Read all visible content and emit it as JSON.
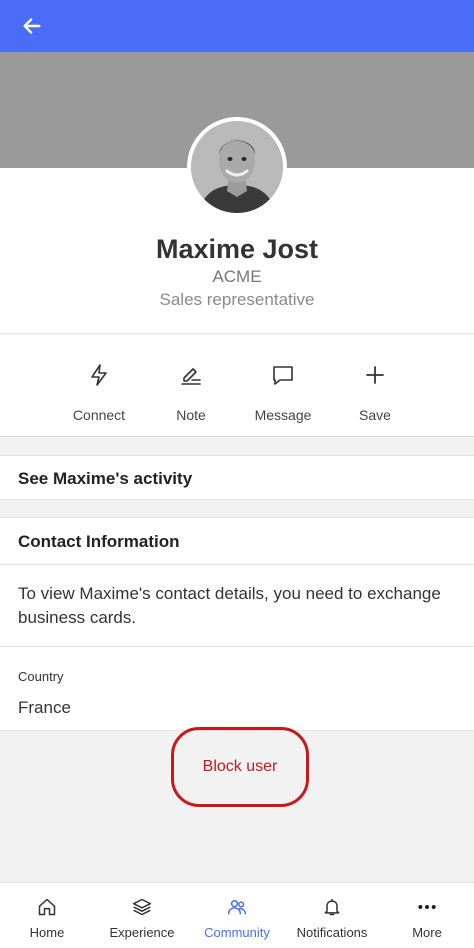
{
  "header": {
    "back_icon": "arrow-left-icon",
    "bg_color": "#4a6cf7"
  },
  "profile": {
    "name": "Maxime Jost",
    "company": "ACME",
    "role": "Sales representative",
    "avatar": "person-photo"
  },
  "actions": [
    {
      "label": "Connect",
      "icon": "lightning-icon"
    },
    {
      "label": "Note",
      "icon": "note-pen-icon"
    },
    {
      "label": "Message",
      "icon": "chat-bubble-icon"
    },
    {
      "label": "Save",
      "icon": "plus-icon"
    }
  ],
  "activity": {
    "label": "See Maxime's activity"
  },
  "contact": {
    "title": "Contact Information",
    "message": "To view Maxime's contact details, you need to exchange business cards.",
    "country_label": "Country",
    "country_value": "France"
  },
  "block": {
    "label": "Block user",
    "color": "#c8181c"
  },
  "nav": [
    {
      "label": "Home",
      "icon": "home-icon",
      "active": false
    },
    {
      "label": "Experience",
      "icon": "layers-icon",
      "active": false
    },
    {
      "label": "Community",
      "icon": "people-icon",
      "active": true
    },
    {
      "label": "Notifications",
      "icon": "bell-icon",
      "active": false
    },
    {
      "label": "More",
      "icon": "more-dots-icon",
      "active": false
    }
  ]
}
